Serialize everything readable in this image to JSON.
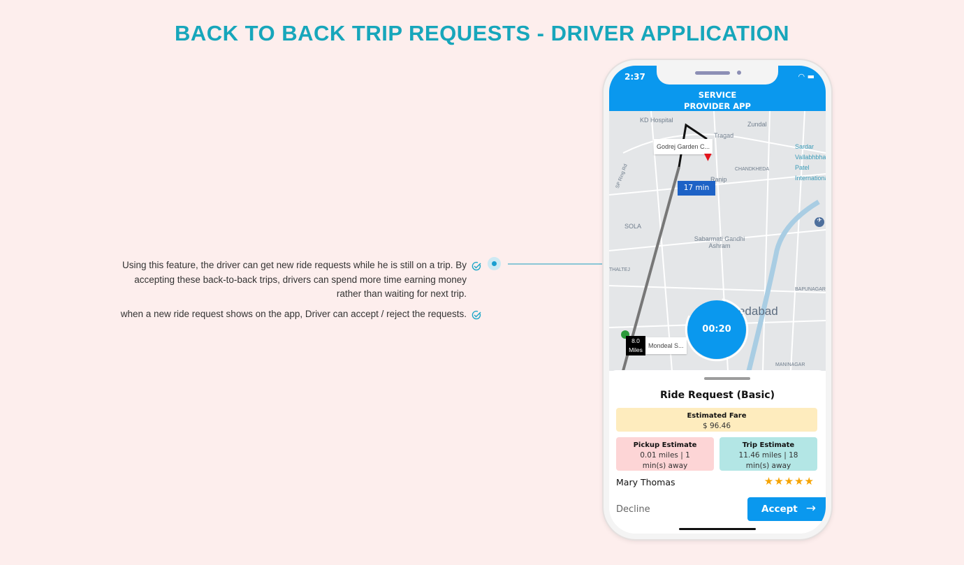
{
  "page": {
    "title": "BACK TO BACK TRIP REQUESTS - DRIVER APPLICATION"
  },
  "features": [
    {
      "text": "Using this feature, the driver can get new ride requests while he is still on a trip. By accepting these back-to-back trips, drivers can spend more time earning money rather than waiting for next trip.",
      "icon": "check-circle-icon"
    },
    {
      "text": "when a new ride request shows on the app, Driver can accept / reject the requests.",
      "icon": "check-circle-icon"
    }
  ],
  "colors": {
    "accent": "#17a6bb",
    "app_blue": "#0a98ee",
    "fare_bg": "#feecbe",
    "pickup_bg": "#fdd5d6",
    "trip_bg": "#b3e6e5",
    "star": "#f6a300"
  },
  "phone": {
    "status": {
      "time": "2:37",
      "icons": [
        "location-arrow-icon",
        "wifi-icon",
        "battery-icon"
      ]
    },
    "app_title": "SERVICE PROVIDER APP",
    "map": {
      "labels": [
        "KD Hospital",
        "Zundal",
        "Tragad",
        "CHANDKHEDA",
        "Ranip",
        "SOLA",
        "Sabarmati Gandhi Ashram",
        "THALTEJ",
        "BAPUNAGAR",
        "MANINAGAR",
        "Ahmedabad",
        "Sardar Vallabhbhai Patel International",
        "SP Ring Rd"
      ],
      "pickup_tag": "Godrej Garden C...",
      "eta_badge": "17 min",
      "distance": "8.0 Miles",
      "dropoff_tag": "Mondeal S..."
    },
    "timer": "00:20",
    "request": {
      "title": "Ride Request (Basic)",
      "fare_label": "Estimated Fare",
      "fare_value": "$ 96.46",
      "pickup_label": "Pickup Estimate",
      "pickup_value": "0.01 miles | 1 min(s) away",
      "trip_label": "Trip Estimate",
      "trip_value": "11.46 miles | 18 min(s) away",
      "rider": "Mary Thomas",
      "rating": 5,
      "decline": "Decline",
      "accept": "Accept"
    }
  }
}
